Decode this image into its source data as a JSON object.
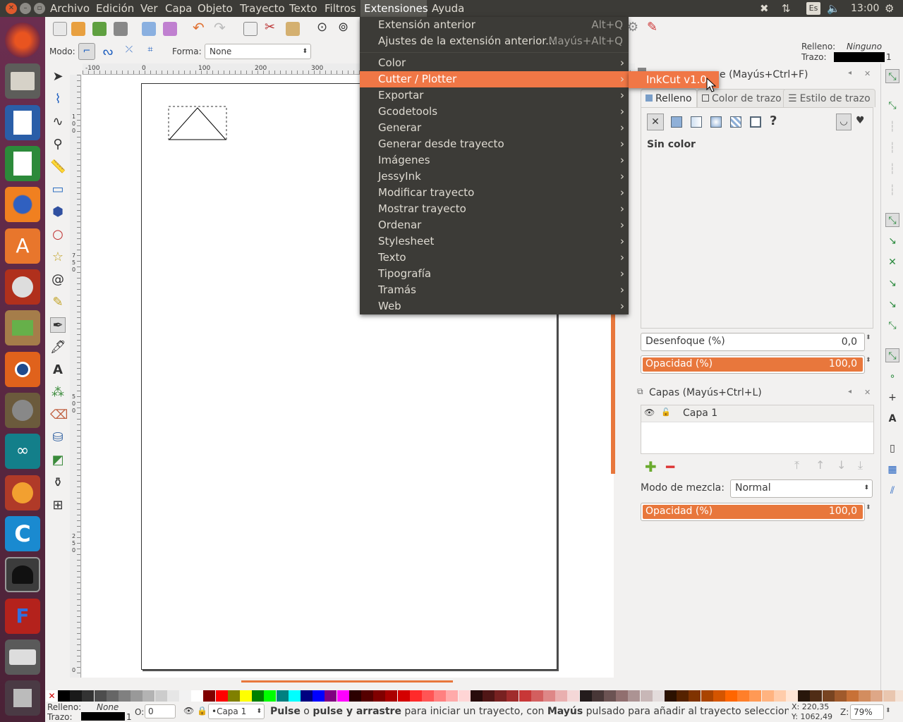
{
  "topbar": {
    "menus": [
      "Archivo",
      "Edición",
      "Ver",
      "Capa",
      "Objeto",
      "Trayecto",
      "Texto",
      "Filtros",
      "Extensiones",
      "Ayuda"
    ],
    "active_menu": "Extensiones",
    "keyboard": "Es",
    "clock": "13:00"
  },
  "launcher": {
    "icons": [
      "ubuntu-dash-icon",
      "files-icon",
      "writer-icon",
      "calc-icon",
      "firefox-icon",
      "software-center-icon",
      "system-settings-icon",
      "archive-manager-icon",
      "blender-icon",
      "gimp-icon",
      "arduino-icon",
      "scratch-icon",
      "codeblocks-icon",
      "inkscape-icon",
      "filezilla-icon",
      "printer-icon",
      "trash-icon"
    ]
  },
  "toolcontrols": {
    "mode_label": "Modo:",
    "shape_label": "Forma:",
    "shape_value": "None"
  },
  "fillstroke_indicator": {
    "fill_label": "Relleno:",
    "fill_value": "Ninguno",
    "stroke_label": "Trazo:",
    "stroke_width": "1"
  },
  "ruler_top": [
    "-100",
    "0",
    "100",
    "200",
    "300"
  ],
  "ruler_left": [
    "1",
    "0",
    "0",
    "7",
    "5",
    "0",
    "5",
    "0",
    "0",
    "2",
    "5",
    "0",
    "0"
  ],
  "extensions_menu": {
    "items": [
      {
        "label": "Extensión anterior",
        "accel": "Alt+Q",
        "submenu": false
      },
      {
        "label": "Ajustes de la extensión anterior...",
        "accel": "Mayús+Alt+Q",
        "submenu": false
      },
      {
        "label": "Color",
        "accel": "",
        "submenu": true
      },
      {
        "label": "Cutter / Plotter",
        "accel": "",
        "submenu": true
      },
      {
        "label": "Exportar",
        "accel": "",
        "submenu": true
      },
      {
        "label": "Gcodetools",
        "accel": "",
        "submenu": true
      },
      {
        "label": "Generar",
        "accel": "",
        "submenu": true
      },
      {
        "label": "Generar desde trayecto",
        "accel": "",
        "submenu": true
      },
      {
        "label": "Imágenes",
        "accel": "",
        "submenu": true
      },
      {
        "label": "JessyInk",
        "accel": "",
        "submenu": true
      },
      {
        "label": "Modificar trayecto",
        "accel": "",
        "submenu": true
      },
      {
        "label": "Mostrar trayecto",
        "accel": "",
        "submenu": true
      },
      {
        "label": "Ordenar",
        "accel": "",
        "submenu": true
      },
      {
        "label": "Stylesheet",
        "accel": "",
        "submenu": true
      },
      {
        "label": "Texto",
        "accel": "",
        "submenu": true
      },
      {
        "label": "Tipografía",
        "accel": "",
        "submenu": true
      },
      {
        "label": "Tramás",
        "accel": "",
        "submenu": true
      },
      {
        "label": "Web",
        "accel": "",
        "submenu": true
      }
    ],
    "highlighted": "Cutter / Plotter",
    "submenu_item": "InkCut v1.0"
  },
  "fillstroke_panel": {
    "title_partial": "e (Mayús+Ctrl+F)",
    "tabs": [
      "Relleno",
      "Color de trazo",
      "Estilo de trazo"
    ],
    "no_paint_text": "Sin color",
    "blur_label": "Desenfoque (%)",
    "blur_value": "0,0",
    "opacity_label": "Opacidad (%)",
    "opacity_value": "100,0"
  },
  "layers_panel": {
    "title": "Capas (Mayús+Ctrl+L)",
    "layers": [
      "Capa 1"
    ],
    "blend_label": "Modo de mezcla:",
    "blend_value": "Normal",
    "opacity_label": "Opacidad (%)",
    "opacity_value": "100,0"
  },
  "status": {
    "fill_label": "Relleno:",
    "fill_value": "None",
    "stroke_label": "Trazo:",
    "stroke_width": "1",
    "opacity_label": "O:",
    "opacity_value": "0",
    "layer": "•Capa 1",
    "msg_b1": "Pulse",
    "msg_t1": " o ",
    "msg_b2": "pulse y arrastre",
    "msg_t2": " para iniciar un trayecto, con ",
    "msg_b3": "Mayús",
    "msg_t3": " pulsado para añadir al trayecto seleccionado. U.",
    "x": "X:  220,35",
    "y": "Y: 1062,49",
    "zoom_label": "Z:",
    "zoom_value": "79%"
  },
  "colors": {
    "accent": "#f07746",
    "menu_bg": "#3c3b37",
    "panel_bar": "#e8773c"
  }
}
